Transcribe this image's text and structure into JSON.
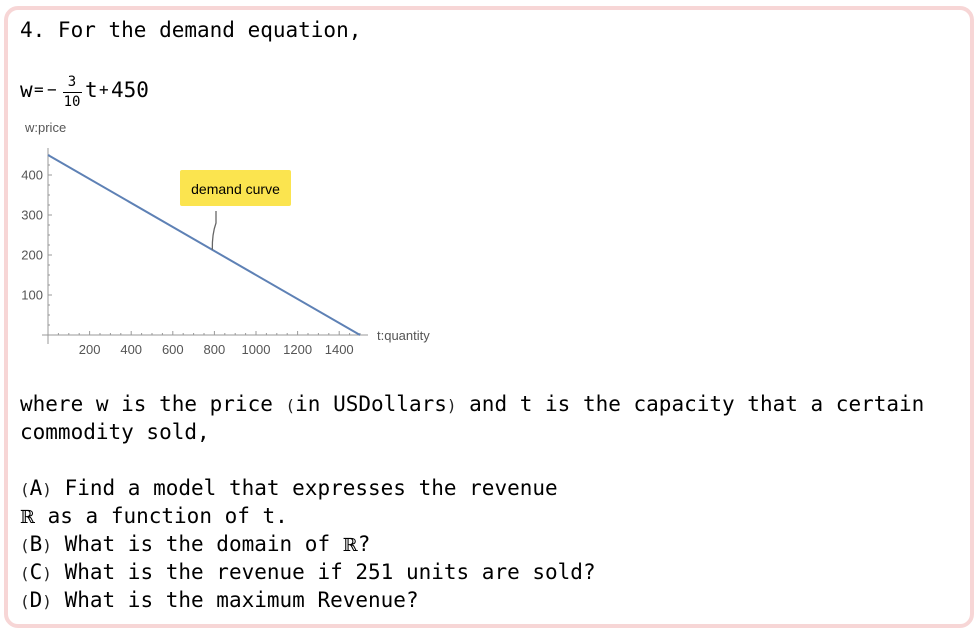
{
  "problem": {
    "heading": "4. For the demand equation,",
    "equation": {
      "lhs": "w",
      "eq": "=",
      "minus": "−",
      "numerator": "3",
      "denominator": "10",
      "var": "t",
      "plus": "+",
      "constant": "450"
    },
    "description_line1_part1": "where w is the price ",
    "description_unit_open": "(",
    "description_unit": "in USDollars",
    "description_unit_close": ")",
    "description_line1_part2": " and t is the capacity that a certain",
    "description_line2": "commodity sold,",
    "questions": [
      {
        "letter": "A",
        "text": " Find a model that expresses the revenue"
      },
      {
        "symbol": "ℝ",
        "text": " as a function of t."
      },
      {
        "letter": "B",
        "text": " What is the domain of ",
        "symbol": "ℝ",
        "suffix": "?"
      },
      {
        "letter": "C",
        "text": " What is the revenue if 251 units are sold?"
      },
      {
        "letter": "D",
        "text": " What is the maximum Revenue?"
      }
    ]
  },
  "chart_data": {
    "type": "line",
    "ylabel": "w:price",
    "xlabel": "t:quantity",
    "xlim": [
      0,
      1500
    ],
    "ylim": [
      0,
      450
    ],
    "xticks": [
      200,
      400,
      600,
      800,
      1000,
      1200,
      1400
    ],
    "yticks": [
      100,
      200,
      300,
      400
    ],
    "series": [
      {
        "x": [
          0,
          1500
        ],
        "y": [
          450,
          0
        ]
      }
    ],
    "annotation": {
      "text": "demand curve",
      "at_x": 790,
      "at_y": 213
    },
    "colors": {
      "line": "#5e81b5",
      "annotation_bg": "#fbe44f",
      "frame": "#f7d6d6"
    }
  }
}
